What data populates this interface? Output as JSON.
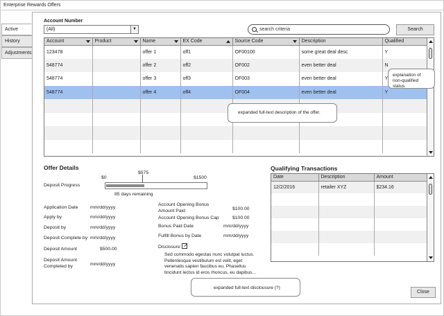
{
  "window": {
    "title": "Enterprise Rewards Offers"
  },
  "tabs": [
    {
      "label": "Active"
    },
    {
      "label": "History"
    },
    {
      "label": "Adjustments"
    }
  ],
  "filter": {
    "account_label": "Account Number",
    "account_value": "(All)",
    "search_placeholder": "search criteria",
    "search_button": "Search"
  },
  "offers_table": {
    "headers": [
      "Account",
      "Product",
      "Name",
      "EX Code",
      "Source Code",
      "Description",
      "Qualified"
    ],
    "rows": [
      [
        "123478",
        "",
        "offer 1",
        "off1",
        "OF00100",
        "some great deal desc",
        "Y"
      ],
      [
        "548774",
        "",
        "offer 2",
        "off2",
        "OF002",
        "even better deal",
        "N"
      ],
      [
        "548774",
        "",
        "offer 3",
        "off3",
        "OF003",
        "even better deal",
        "Y"
      ],
      [
        "548774",
        "",
        "offer 4",
        "off4",
        "OF004",
        "even better deal",
        "Y"
      ]
    ],
    "selected_row": 3
  },
  "callouts": {
    "qualified": "explanaiton of non-qualified status",
    "description": "expanded full-text description of the offer.",
    "disclosure": "expanded full-text disclousure (?)"
  },
  "offer_details": {
    "title": "Offer Details",
    "progress": {
      "label": "Deposit Progress",
      "min_label": "$0",
      "current_label": "$575",
      "max_label": "$1500",
      "fraction": 0.383,
      "remaining": "85 days remaining"
    },
    "left_fields": [
      {
        "label": "Application Date",
        "value": "mm/dd/yyyy"
      },
      {
        "label": "Apply by",
        "value": "mm/dd/yyyy"
      },
      {
        "label": "Deposit by",
        "value": "mm/dd/yyyy"
      },
      {
        "label": "Deposit Complete by",
        "value": "mm/dd/yyyy"
      },
      {
        "label": "Deposit Amount",
        "value": "$500.00"
      },
      {
        "label": "Deposit Amount Completed by",
        "value": "mm/dd/yyyy"
      }
    ],
    "right_fields": [
      {
        "label": "Account Opening Bonus Amount Paid",
        "value": "$100.00"
      },
      {
        "label": "Account Opening Bonus Cap",
        "value": "$100.00"
      },
      {
        "label": "Bonus Paid Date",
        "value": "mm/dd/yyyy"
      },
      {
        "label": "Fulfill Bonus by Date",
        "value": "mm/dd/yyyy"
      }
    ],
    "disclosure_label": "Disclosure",
    "disclosure_text": "Sed commodo egestas nunc volutpat luctus. Pellentesque vestibulum est velit, eget venenatis sapien faucibus eu. Phasellus tincidunt lectus id eros rhoncus, eu dapibus..."
  },
  "qualifying": {
    "title": "Qualifying Transactions",
    "headers": [
      "Date",
      "Description",
      "Amount"
    ],
    "rows": [
      [
        "12/2/2016",
        "retailer XYZ",
        "$234.16"
      ]
    ]
  },
  "footer": {
    "close": "Close"
  }
}
